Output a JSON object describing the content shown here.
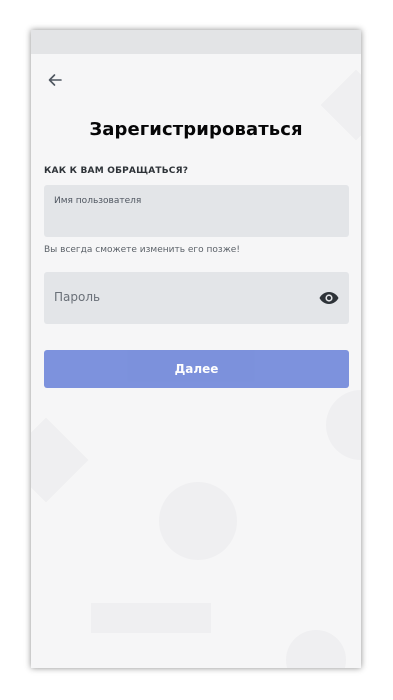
{
  "header": {
    "back_icon": "arrow-left-icon"
  },
  "form": {
    "title": "Зарегистрироваться",
    "section_label": "КАК К ВАМ ОБРАЩАТЬСЯ?",
    "username": {
      "label": "Имя пользователя",
      "value": ""
    },
    "hint": "Вы всегда сможете изменить его позже!",
    "password": {
      "placeholder": "Пароль",
      "toggle_icon": "eye-icon"
    },
    "submit_label": "Далее"
  },
  "colors": {
    "primary_button": "#7289da",
    "input_background": "#e3e5e8",
    "screen_background": "#f6f6f7"
  }
}
